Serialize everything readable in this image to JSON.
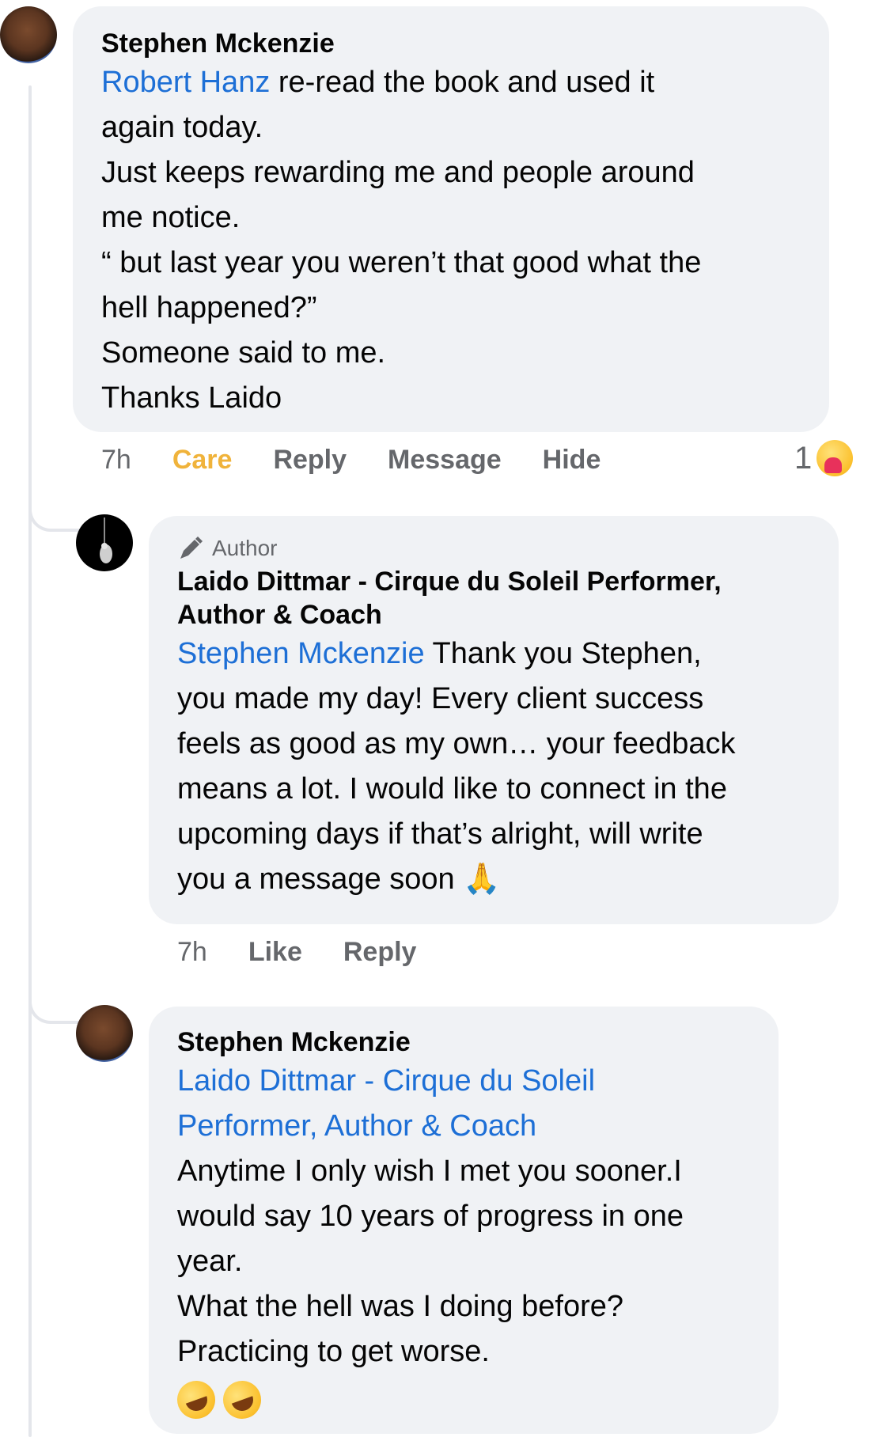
{
  "comments": [
    {
      "author": "Stephen Mckenzie",
      "mention": "Robert Hanz",
      "lines": [
        " re-read the book and used it",
        "again today.",
        "Just keeps rewarding me and people around",
        "me notice.",
        "“ but last year you weren’t that good what the",
        "hell happened?”",
        "Someone said to me.",
        "Thanks Laido"
      ],
      "time": "7h",
      "actions": [
        "Care",
        "Reply",
        "Message",
        "Hide"
      ],
      "reaction_count": "1",
      "reaction_icon": "care-emoji-icon"
    },
    {
      "badge": "Author",
      "author_line1": "Laido Dittmar - Cirque du Soleil Performer,",
      "author_line2": "Author & Coach",
      "mention": "Stephen Mckenzie",
      "lines": [
        " Thank you Stephen,",
        "you made my day! Every client success",
        "feels as good as my own… your feedback",
        "means a lot. I would like to connect in the",
        "upcoming days if that’s alright, will write",
        "you a message soon "
      ],
      "emoji": "🙏",
      "time": "7h",
      "actions": [
        "Like",
        "Reply"
      ]
    },
    {
      "author": "Stephen Mckenzie",
      "mention_line1": "Laido Dittmar - Cirque du Soleil",
      "mention_line2": "Performer, Author & Coach",
      "lines": [
        "Anytime I only wish I met you sooner.I",
        "would say 10 years of progress in one",
        "year.",
        "What the hell was I doing before?",
        "Practicing to get worse."
      ],
      "emoji_icons": [
        "rofl-emoji-icon",
        "rofl-emoji-icon"
      ]
    }
  ],
  "colors": {
    "bubble": "#f0f2f5",
    "mention": "#1d6fd6",
    "care": "#f0b33b",
    "muted": "#65676b"
  }
}
